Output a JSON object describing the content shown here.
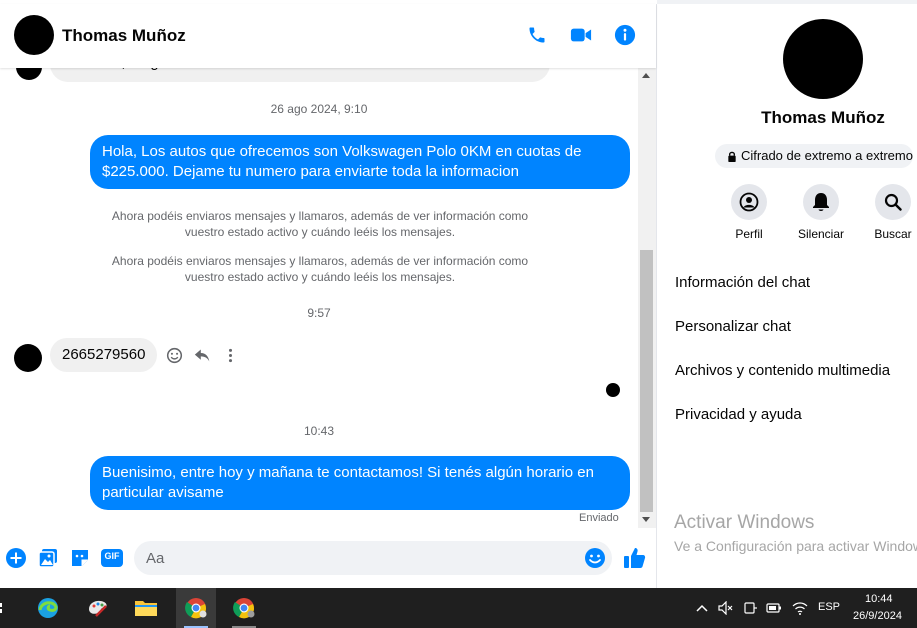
{
  "header": {
    "contact_name": "Thomas Muñoz"
  },
  "messages": {
    "partial_text": "financias, tengo recibo de sueldo",
    "timestamp_1": "26 ago 2024, 9:10",
    "outgoing_1": "Hola, Los autos que ofrecemos son Volkswagen Polo 0KM en cuotas de $225.000. Dejame tu numero para enviarte toda la informacion",
    "system_note_1": "Ahora podéis enviaros mensajes y llamaros, además de ver información como vuestro estado activo y cuándo leéis los mensajes.",
    "system_note_2": "Ahora podéis enviaros mensajes y llamaros, además de ver información como vuestro estado activo y cuándo leéis los mensajes.",
    "timestamp_2": "9:57",
    "incoming_1": "2665279560",
    "timestamp_3": "10:43",
    "outgoing_2": "Buenisimo, entre hoy y mañana te contactamos! Si tenés algún horario en particular avisame",
    "status": "Enviado"
  },
  "composer": {
    "placeholder": "Aa",
    "gif_label": "GIF"
  },
  "panel": {
    "name": "Thomas Muñoz",
    "e2e_label": "Cifrado de extremo a extremo",
    "actions": [
      {
        "label": "Perfil",
        "icon": "profile-icon"
      },
      {
        "label": "Silenciar",
        "icon": "bell-icon"
      },
      {
        "label": "Buscar",
        "icon": "search-icon"
      }
    ],
    "menu": [
      "Información del chat",
      "Personalizar chat",
      "Archivos y contenido multimedia",
      "Privacidad y ayuda"
    ],
    "watermark_title": "Activar Windows",
    "watermark_sub": "Ve a Configuración para activar Windows."
  },
  "taskbar": {
    "lang": "ESP",
    "time": "10:44",
    "date": "26/9/2024"
  },
  "colors": {
    "accent": "#0084ff",
    "bubble_in": "#f0f0f0",
    "taskbar": "#1f1f1f"
  }
}
